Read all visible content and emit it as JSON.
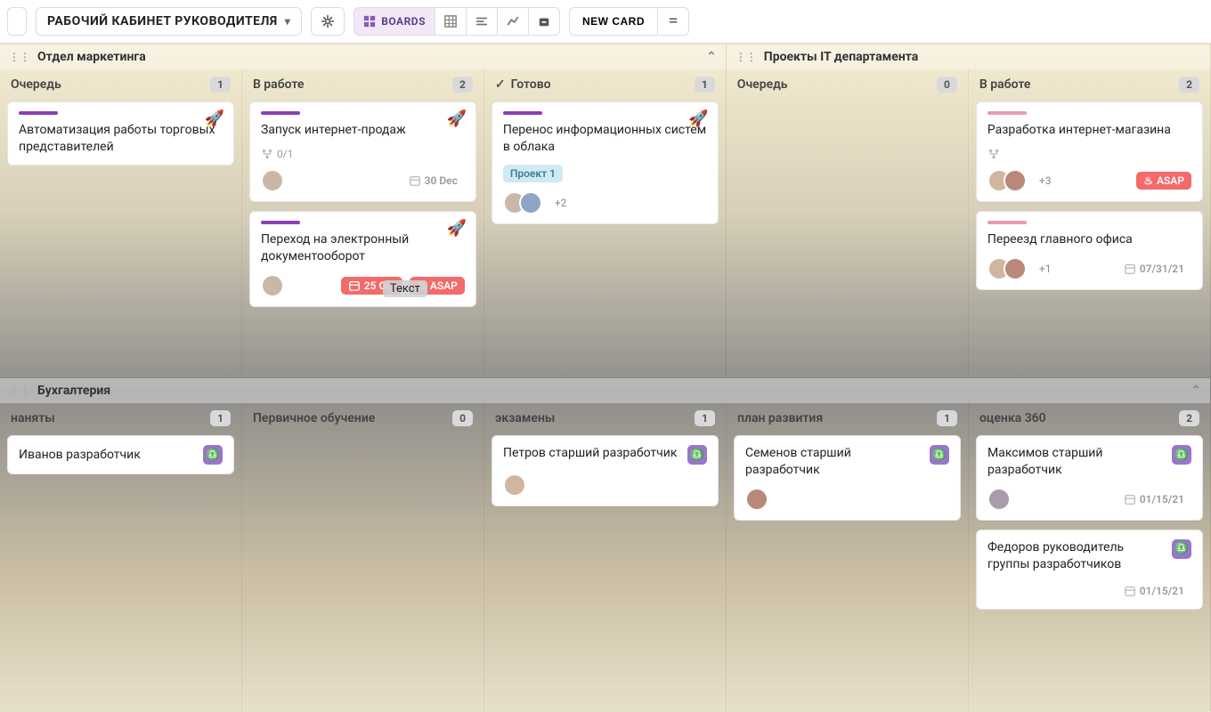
{
  "topbar": {
    "workspace": "РАБОЧИЙ КАБИНЕТ РУКОВОДИТЕЛЯ",
    "boards_label": "BOARDS",
    "new_card": "NEW CARD"
  },
  "lanes": [
    {
      "title": "Отдел маркетинга",
      "columns": [
        {
          "title": "Очередь",
          "count": "1",
          "check": false,
          "cards": [
            {
              "stripe": "purple",
              "title": "Автоматизация работы торговых представителей",
              "rocket": true
            }
          ]
        },
        {
          "title": "В работе",
          "count": "2",
          "check": false,
          "cards": [
            {
              "stripe": "purple",
              "title": "Запуск интернет-продаж",
              "rocket": true,
              "subtasks": "0/1",
              "avatars": 1,
              "date": "30 Dec",
              "date_style": "grey"
            },
            {
              "stripe": "purple",
              "title": "Переход на электронный документооборот",
              "rocket": true,
              "avatars": 1,
              "date": "25 Oct",
              "date_style": "red",
              "asap": "ASAP",
              "overlay": "Текст"
            }
          ]
        },
        {
          "title": "Готово",
          "count": "1",
          "check": true,
          "cards": [
            {
              "stripe": "purple",
              "title": "Перенос информационных систем в облака",
              "rocket": true,
              "tag": "Проект 1",
              "avatars": 2,
              "more_avatars": "+2"
            }
          ]
        }
      ]
    },
    {
      "title": "Проекты IT департамента",
      "columns": [
        {
          "title": "Очередь",
          "count": "0",
          "check": false,
          "cards": []
        },
        {
          "title": "В работе",
          "count": "2",
          "check": false,
          "cards": [
            {
              "stripe": "pink",
              "title": "Разработка интернет-магазина",
              "subtasks_icon": true,
              "avatars": 2,
              "more_avatars": "+3",
              "asap": "ASAP"
            },
            {
              "stripe": "pink",
              "title": "Переезд главного офиса",
              "avatars": 2,
              "more_avatars": "+1",
              "date": "07/31/21",
              "date_style": "plain"
            }
          ]
        }
      ]
    }
  ],
  "lanes2": [
    {
      "title": "Бухгалтерия",
      "columns": [
        {
          "title": "наняты",
          "count": "1",
          "cards": [
            {
              "title": "Иванов разработчик",
              "scales": true
            }
          ]
        },
        {
          "title": "Первичное обучение",
          "count": "0",
          "cards": []
        },
        {
          "title": "экзамены",
          "count": "1",
          "cards": [
            {
              "title": "Петров старший разработчик",
              "scales": true,
              "avatars": 1
            }
          ]
        },
        {
          "title": "план развития",
          "count": "1",
          "cards": [
            {
              "title": "Семенов старший разработчик",
              "scales": true,
              "avatars": 1
            }
          ]
        },
        {
          "title": "оценка 360",
          "count": "2",
          "cards": [
            {
              "title": "Максимов старший разработчик",
              "scales": true,
              "avatars": 1,
              "date": "01/15/21",
              "date_style": "plain"
            },
            {
              "title": "Федоров руководитель группы разработчиков",
              "scales": true,
              "date": "01/15/21",
              "date_style": "plain"
            }
          ]
        }
      ]
    }
  ]
}
